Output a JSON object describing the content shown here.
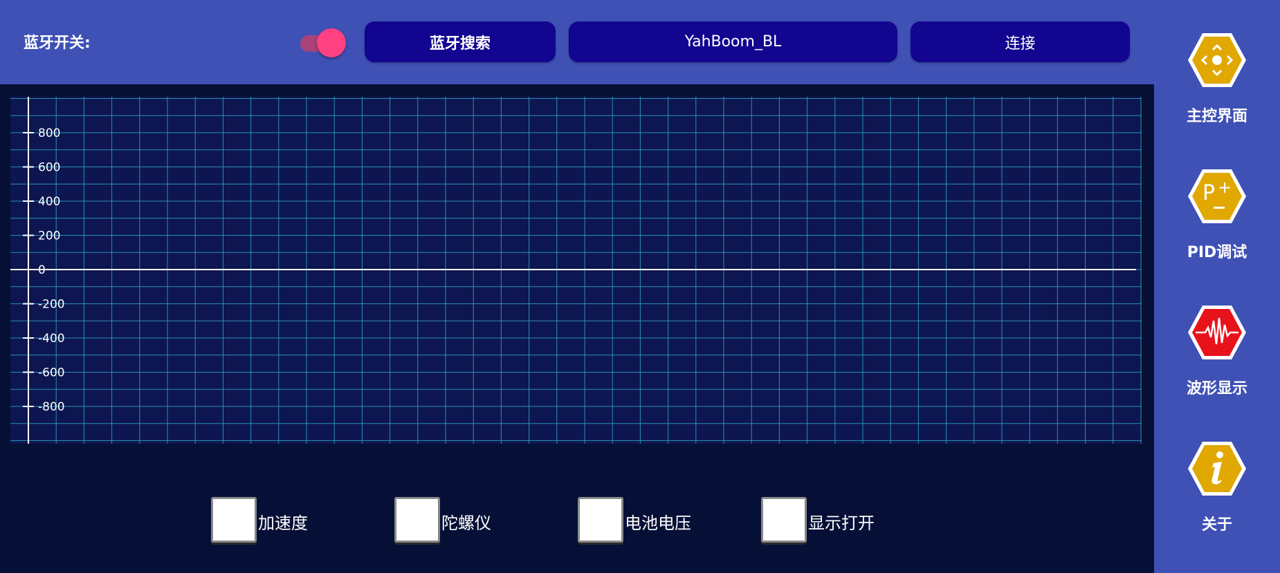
{
  "topbar": {
    "bluetooth_label": "蓝牙开关:",
    "bluetooth_switch_on": true,
    "search_button": "蓝牙搜索",
    "device_name": "YahBoom_BL",
    "connect_button": "连接"
  },
  "sidebar": {
    "items": [
      {
        "label": "主控界面",
        "icon": "joystick-icon",
        "color": "#e0a800"
      },
      {
        "label": "PID调试",
        "icon": "pid-adjust-icon",
        "color": "#e0a800"
      },
      {
        "label": "波形显示",
        "icon": "waveform-icon",
        "color": "#e8121b"
      },
      {
        "label": "关于",
        "icon": "info-icon",
        "color": "#e0a800"
      }
    ]
  },
  "chart_data": {
    "type": "line",
    "series": [],
    "ylim": [
      -1000,
      1000
    ],
    "yticks": [
      800,
      600,
      400,
      200,
      0,
      -200,
      -400,
      -600,
      -800
    ],
    "grid": true,
    "colors": {
      "background": "#0d1650",
      "grid": "#2fa6c6",
      "axis": "#ffffff"
    }
  },
  "checkboxes": [
    {
      "label": "加速度",
      "checked": false
    },
    {
      "label": "陀螺仪",
      "checked": false
    },
    {
      "label": "电池电压",
      "checked": false
    },
    {
      "label": "显示打开",
      "checked": false
    }
  ]
}
